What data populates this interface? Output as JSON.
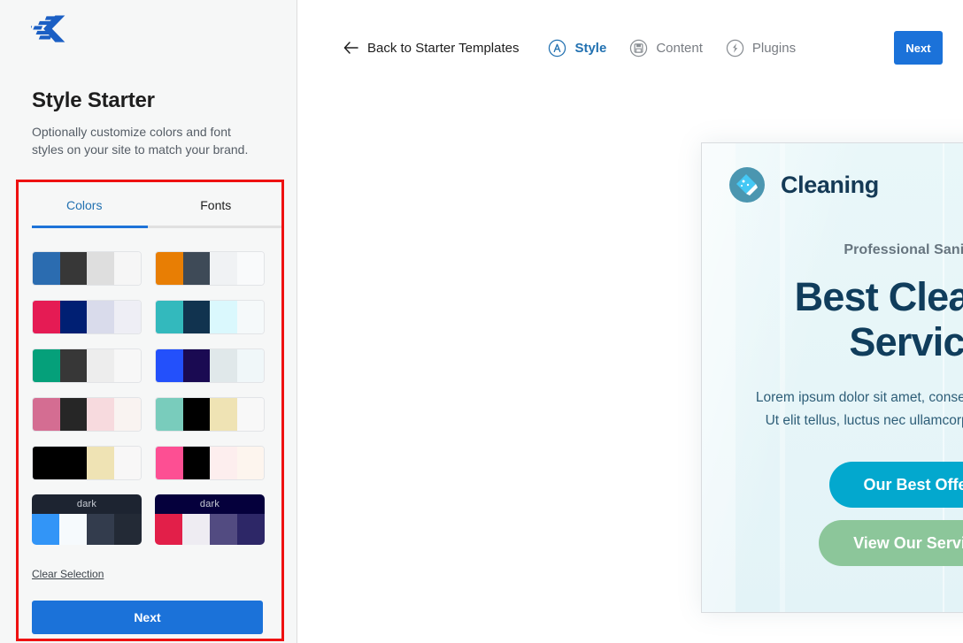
{
  "sidebar": {
    "logo_icon": "kadence-logo-icon",
    "title": "Style Starter",
    "subtitle": "Optionally customize colors and font styles on your site to match your brand.",
    "tabs": [
      {
        "label": "Colors",
        "active": true
      },
      {
        "label": "Fonts",
        "active": false
      }
    ],
    "clear_selection_label": "Clear Selection",
    "next_label": "Next",
    "dark_badge_label": "dark",
    "highlight_color": "#ee1111",
    "accent_color": "#1b72d9",
    "palettes": [
      {
        "id": "palette-1",
        "dark": false,
        "swatches": [
          "#2b6cb0",
          "#373737",
          "#dedede",
          "#f6f6f6"
        ]
      },
      {
        "id": "palette-2",
        "dark": false,
        "swatches": [
          "#e87e04",
          "#3e4a57",
          "#f0f2f4",
          "#f9fafb"
        ]
      },
      {
        "id": "palette-3",
        "dark": false,
        "swatches": [
          "#e51b54",
          "#001f73",
          "#d9dbeb",
          "#eeeef5"
        ]
      },
      {
        "id": "palette-4",
        "dark": false,
        "swatches": [
          "#33b9bd",
          "#11334f",
          "#daf8fd",
          "#f5f9fa"
        ]
      },
      {
        "id": "palette-5",
        "dark": false,
        "swatches": [
          "#05a07a",
          "#373737",
          "#ededed",
          "#f7f7f7"
        ]
      },
      {
        "id": "palette-6",
        "dark": false,
        "swatches": [
          "#2350fb",
          "#1a0a52",
          "#e0e8ea",
          "#f0f7f9"
        ]
      },
      {
        "id": "palette-7",
        "dark": false,
        "swatches": [
          "#d46d92",
          "#262626",
          "#f7dade",
          "#f9f3f1"
        ]
      },
      {
        "id": "palette-8",
        "dark": false,
        "swatches": [
          "#79ccbc",
          "#000000",
          "#efe3b4",
          "#f8f8f8"
        ]
      },
      {
        "id": "palette-9",
        "dark": false,
        "swatches": [
          "#000000",
          "#000000",
          "#efe3b4",
          "#f8f7f7"
        ]
      },
      {
        "id": "palette-10",
        "dark": false,
        "swatches": [
          "#fd4f93",
          "#000000",
          "#fdeeee",
          "#fdf5ee"
        ]
      },
      {
        "id": "palette-11",
        "dark": true,
        "header": "#1d2431",
        "swatches": [
          "#3295f7",
          "#f6fafd",
          "#333c4d",
          "#232a36"
        ]
      },
      {
        "id": "palette-12",
        "dark": true,
        "header": "#05003c",
        "swatches": [
          "#e21f49",
          "#eeecf2",
          "#524b81",
          "#2d2767"
        ]
      }
    ]
  },
  "topbar": {
    "back_label": "Back to Starter Templates",
    "steps": [
      {
        "label": "Style",
        "icon": "style-icon",
        "active": true
      },
      {
        "label": "Content",
        "icon": "content-icon",
        "active": false
      },
      {
        "label": "Plugins",
        "icon": "plugins-icon",
        "active": false
      }
    ],
    "next_label": "Next"
  },
  "preview": {
    "brand_name": "Cleaning",
    "brand_logo_icon": "cleaning-brush-icon",
    "menu_icon": "hamburger-menu-icon",
    "eyebrow": "Professional Sanitizing",
    "heading_line1": "Best Cleaning",
    "heading_line2": "Service.",
    "body_line1": "Lorem ipsum dolor sit amet, consectetur adipiscing elit.",
    "body_line2": "Ut elit tellus, luctus nec ullamcorper mattis, pulvinar.",
    "primary_button": "Our Best Offers",
    "secondary_button": "View Our Services",
    "primary_button_color": "#03a8ce",
    "secondary_button_color": "#8cc69a",
    "heading_color": "#103d5c",
    "background_color": "#e8f6f8"
  }
}
